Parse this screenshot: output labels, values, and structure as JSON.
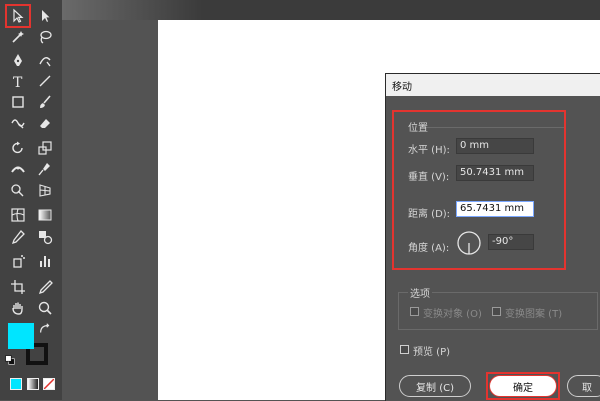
{
  "app": {
    "accent": "#e3342f",
    "fill_color": "#00e5ff"
  },
  "toolbar": {
    "tools": [
      "selection-tool-icon",
      "direct-selection-tool-icon",
      "magic-wand-icon",
      "lasso-icon",
      "pen-icon",
      "curvature-pen-icon",
      "type-tool-icon",
      "line-tool-icon",
      "rectangle-tool-icon",
      "paintbrush-icon",
      "shaper-tool-icon",
      "eraser-icon",
      "rotate-icon",
      "scale-icon",
      "width-tool-icon",
      "puppet-warp-icon",
      "shape-builder-icon",
      "perspective-grid-icon",
      "mesh-icon",
      "gradient-icon",
      "eyedropper-icon",
      "blend-icon",
      "symbol-sprayer-icon",
      "column-graph-icon",
      "artboard-icon",
      "slice-icon",
      "hand-icon",
      "zoom-icon"
    ]
  },
  "dialog": {
    "title": "移动",
    "position_group": "位置",
    "horizontal_label": "水平 (H):",
    "horizontal_value": "0 mm",
    "vertical_label": "垂直 (V):",
    "vertical_value": "50.7431 mm",
    "distance_label": "距离 (D):",
    "distance_value": "65.7431 mm",
    "angle_label": "角度 (A):",
    "angle_value": "-90°",
    "options_group": "选项",
    "transform_objects": "变换对象 (O)",
    "transform_patterns": "变换图案 (T)",
    "preview_label": "预览 (P)",
    "copy_button": "复制 (C)",
    "ok_button": "确定",
    "cancel_button": "取"
  }
}
